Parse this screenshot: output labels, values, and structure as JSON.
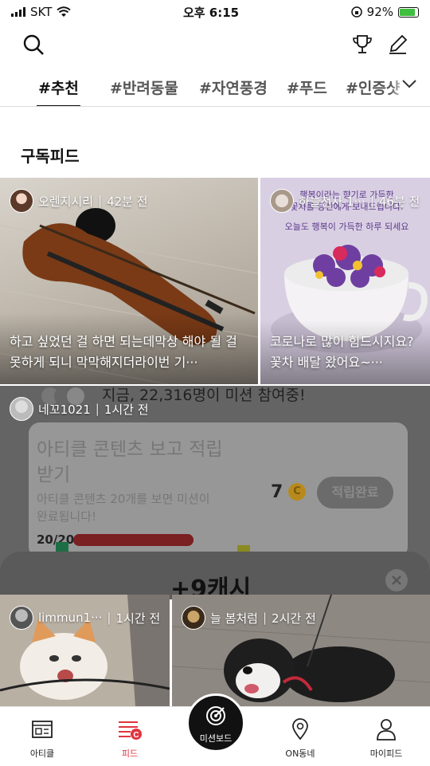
{
  "status": {
    "carrier": "SKT",
    "time": "오후 6:15",
    "battery": "92%"
  },
  "tabs": [
    {
      "label": "#추천"
    },
    {
      "label": "#반려동물"
    },
    {
      "label": "#자연풍경"
    },
    {
      "label": "#푸드"
    },
    {
      "label": "#인증샷"
    }
  ],
  "section_title": "구독피드",
  "cards": [
    {
      "author": "오렌지시리",
      "time": "42분 전",
      "caption": "하고 싶었던 걸 하면 되는데막상 해야 될 걸 못하게 되니 막막해지더라이번 기···"
    },
    {
      "author": "하늘천사 1···",
      "time": "46분 전",
      "caption": "코로나로 많이 힘드시지요?꽃차 배달 왔어요~···",
      "image_text_1": "행복이라는 향기로 가득한",
      "image_text_2": "꽃차를 당신에게 보내드립니다.",
      "image_text_3": "오늘도 행복이 가득한 하루 되세요"
    },
    {
      "author": "네꼬1021",
      "time": "1시간 전"
    },
    {
      "author": "limmun1···",
      "time": "1시간 전"
    },
    {
      "author": "늘 봄처럼",
      "time": "2시간 전"
    }
  ],
  "overlay": {
    "banner": "지금, 22,316명이 미션 참여중!",
    "mission_title_1": "아티클 콘텐츠 보고 적립",
    "mission_title_2": "받기",
    "mission_desc_1": "아티클 콘텐츠 20개를 보면 미션이",
    "mission_desc_2": "완료됩니다!",
    "progress": "20/20",
    "progress_fraction": 1,
    "reward": "7",
    "complete_label": "적립완료",
    "cash": "+9캐시"
  },
  "nav": [
    {
      "label": "아티클"
    },
    {
      "label": "피드"
    },
    {
      "label": "미션보드"
    },
    {
      "label": "ON동네"
    },
    {
      "label": "마이피드"
    }
  ],
  "colors": {
    "accent": "#e0343f",
    "progress": "#b03030"
  }
}
